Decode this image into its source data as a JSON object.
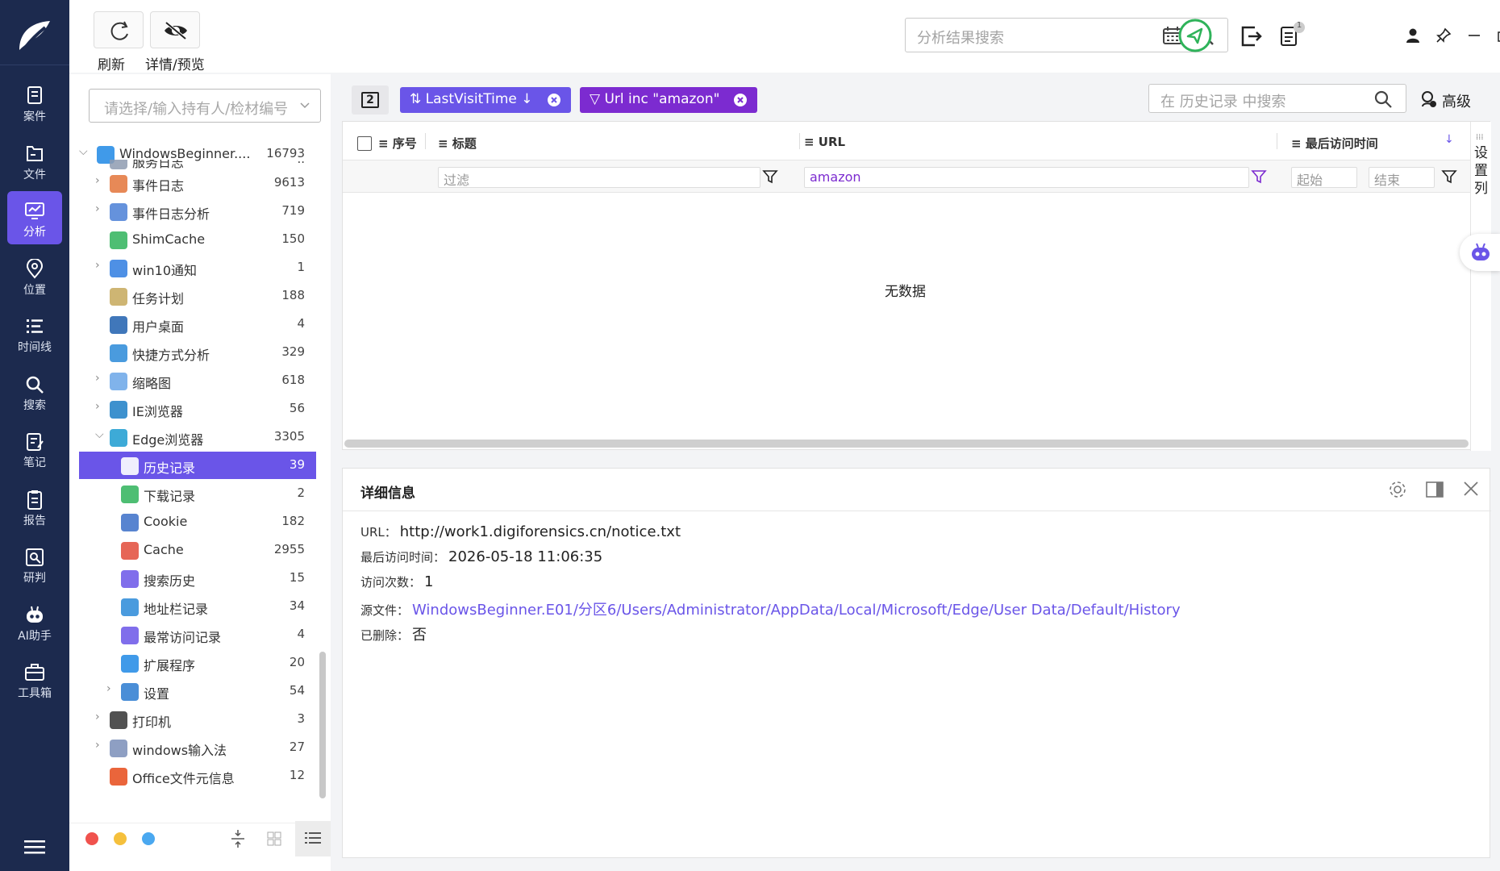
{
  "sidebar_nav": {
    "items": [
      {
        "label": "案件",
        "icon": "case-icon"
      },
      {
        "label": "文件",
        "icon": "file-icon"
      },
      {
        "label": "分析",
        "icon": "analysis-icon",
        "active": true
      },
      {
        "label": "位置",
        "icon": "location-icon"
      },
      {
        "label": "时间线",
        "icon": "timeline-icon"
      },
      {
        "label": "搜索",
        "icon": "search-icon"
      },
      {
        "label": "笔记",
        "icon": "note-icon"
      },
      {
        "label": "报告",
        "icon": "report-icon"
      },
      {
        "label": "研判",
        "icon": "judge-icon"
      },
      {
        "label": "AI助手",
        "icon": "robot-icon"
      },
      {
        "label": "工具箱",
        "icon": "toolbox-icon"
      }
    ],
    "accent": "#6a55e8",
    "bg": "#1c2a4e"
  },
  "toolbar": {
    "refresh_label": "刷新",
    "detail_preview_label": "详情/预览",
    "search_placeholder": "分析结果搜索",
    "badge_count": "1"
  },
  "left_panel": {
    "case_select_placeholder": "请选择/输入持有人/检材编号",
    "tree": [
      {
        "label": "WindowsBeginner....",
        "count": "16793",
        "level": 0,
        "expanded": true
      },
      {
        "label": "服务日志",
        "count": "..",
        "level": 1,
        "partial": true
      },
      {
        "label": "事件日志",
        "count": "9613",
        "level": 1,
        "expandable": true
      },
      {
        "label": "事件日志分析",
        "count": "719",
        "level": 1,
        "expandable": true
      },
      {
        "label": "ShimCache",
        "count": "150",
        "level": 1
      },
      {
        "label": "win10通知",
        "count": "1",
        "level": 1,
        "expandable": true
      },
      {
        "label": "任务计划",
        "count": "188",
        "level": 1
      },
      {
        "label": "用户桌面",
        "count": "4",
        "level": 1
      },
      {
        "label": "快捷方式分析",
        "count": "329",
        "level": 1
      },
      {
        "label": "缩略图",
        "count": "618",
        "level": 1,
        "expandable": true
      },
      {
        "label": "IE浏览器",
        "count": "56",
        "level": 1,
        "expandable": true
      },
      {
        "label": "Edge浏览器",
        "count": "3305",
        "level": 1,
        "expanded": true
      },
      {
        "label": "历史记录",
        "count": "39",
        "level": 2,
        "selected": true
      },
      {
        "label": "下载记录",
        "count": "2",
        "level": 2
      },
      {
        "label": "Cookie",
        "count": "182",
        "level": 2
      },
      {
        "label": "Cache",
        "count": "2955",
        "level": 2
      },
      {
        "label": "搜索历史",
        "count": "15",
        "level": 2
      },
      {
        "label": "地址栏记录",
        "count": "34",
        "level": 2
      },
      {
        "label": "最常访问记录",
        "count": "4",
        "level": 2
      },
      {
        "label": "扩展程序",
        "count": "20",
        "level": 2
      },
      {
        "label": "设置",
        "count": "54",
        "level": 2,
        "expandable": true
      },
      {
        "label": "打印机",
        "count": "3",
        "level": 1,
        "expandable": true
      },
      {
        "label": "windows输入法",
        "count": "27",
        "level": 1,
        "expandable": true
      },
      {
        "label": "Office文件元信息",
        "count": "12",
        "level": 1
      }
    ]
  },
  "filter_bar": {
    "page_indicator": "2",
    "sort_chip": "LastVisitTime",
    "filter_chip": "Url inc \"amazon\"",
    "search_placeholder": "在 历史记录 中搜索",
    "advanced_label": "高级"
  },
  "grid": {
    "columns": [
      "序号",
      "标题",
      "URL",
      "最后访问时间"
    ],
    "title_filter_placeholder": "过滤",
    "url_filter_value": "amazon",
    "start_placeholder": "起始",
    "end_placeholder": "结束",
    "empty_text": "无数据",
    "settings_columns_label": [
      "设",
      "置",
      "列"
    ]
  },
  "detail": {
    "title": "详细信息",
    "url_label": "URL：",
    "url_value": "http://work1.digiforensics.cn/notice.txt",
    "last_visit_label": "最后访问时间：",
    "last_visit_value": "2026-05-18 11:06:35",
    "visit_count_label": "访问次数：",
    "visit_count_value": "1",
    "source_label": "源文件：",
    "source_value": "WindowsBeginner.E01/分区6/Users/Administrator/AppData/Local/Microsoft/Edge/User Data/Default/History",
    "deleted_label": "已删除：",
    "deleted_value": "否"
  },
  "colors": {
    "sort_chip": "#6a55e8",
    "filter_chip": "#7c2bd0",
    "red_dot": "#f0524d",
    "yellow_dot": "#f5c03c",
    "blue_dot": "#4aa8f0",
    "green_send": "#2fb35a"
  }
}
